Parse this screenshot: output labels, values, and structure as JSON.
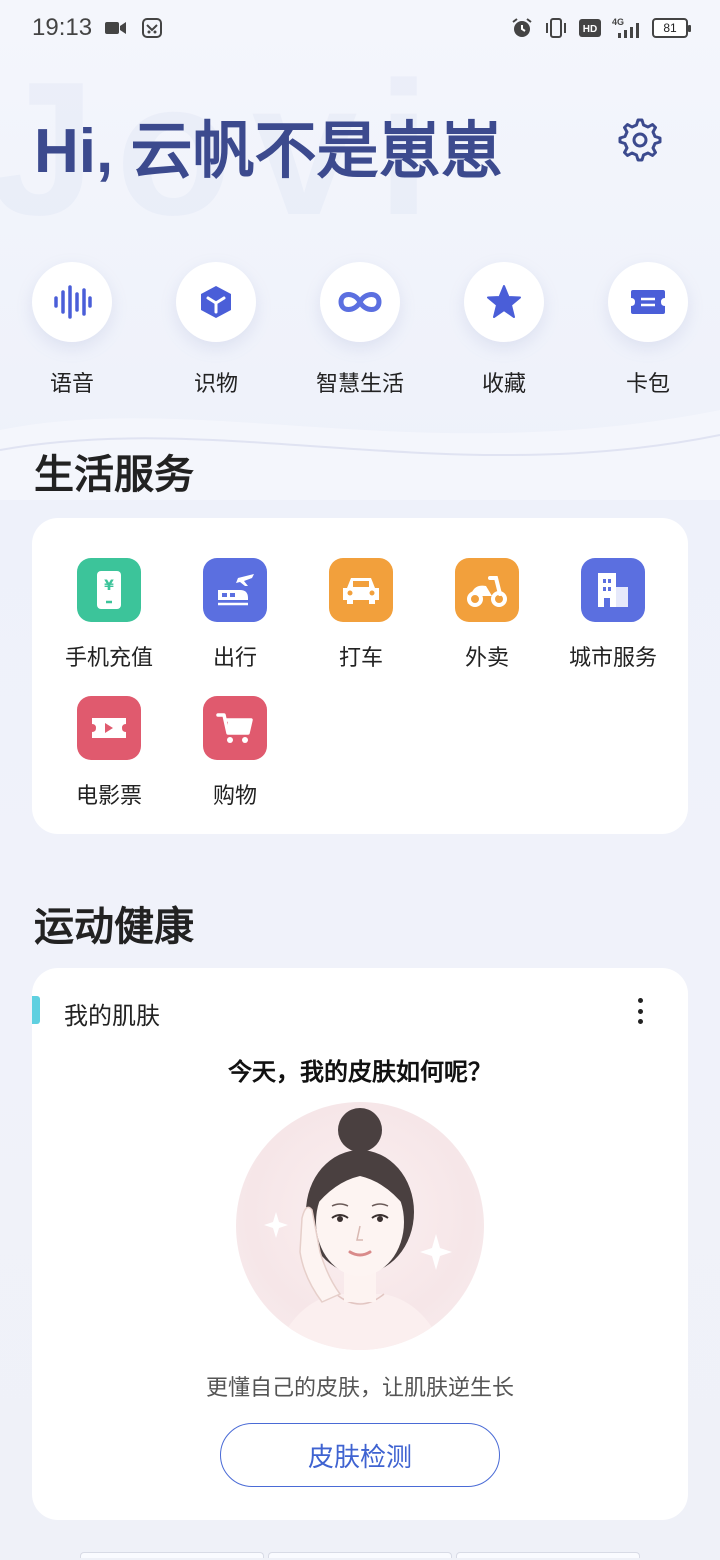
{
  "status_bar": {
    "time": "19:13",
    "battery": "81",
    "network": "4G"
  },
  "header": {
    "greeting": "Hi, 云帆不是崽崽",
    "watermark": "Jovi"
  },
  "quick_actions": [
    {
      "label": "语音",
      "icon": "voice-wave-icon"
    },
    {
      "label": "识物",
      "icon": "cube-icon"
    },
    {
      "label": "智慧生活",
      "icon": "infinity-icon"
    },
    {
      "label": "收藏",
      "icon": "star-icon"
    },
    {
      "label": "卡包",
      "icon": "ticket-icon"
    }
  ],
  "life_services": {
    "title": "生活服务",
    "items": [
      {
        "label": "手机充值",
        "icon": "phone-recharge-icon",
        "color": "#3cc49a"
      },
      {
        "label": "出行",
        "icon": "train-plane-icon",
        "color": "#5b6fe0"
      },
      {
        "label": "打车",
        "icon": "car-icon",
        "color": "#f2a03c"
      },
      {
        "label": "外卖",
        "icon": "scooter-icon",
        "color": "#f2a03c"
      },
      {
        "label": "城市服务",
        "icon": "building-icon",
        "color": "#5b6fe0"
      },
      {
        "label": "电影票",
        "icon": "movie-ticket-icon",
        "color": "#e05a6e"
      },
      {
        "label": "购物",
        "icon": "cart-icon",
        "color": "#e05a6e"
      }
    ]
  },
  "sports_health": {
    "title": "运动健康",
    "card": {
      "title": "我的肌肤",
      "question": "今天，我的皮肤如何呢？",
      "description": "更懂自己的皮肤，让肌肤逆生长",
      "button": "皮肤检测"
    }
  }
}
